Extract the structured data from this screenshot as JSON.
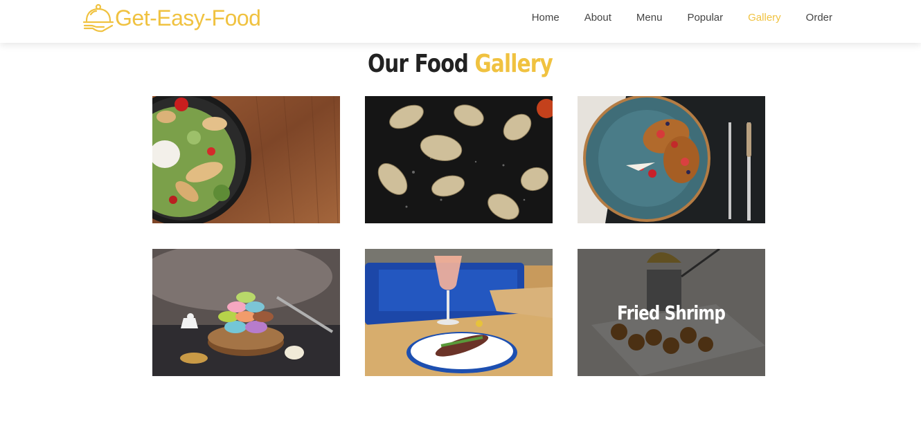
{
  "brand": {
    "name": "Get-Easy-Food",
    "logo_icon": "cloche-icon",
    "accent_color": "#f0c240"
  },
  "nav": {
    "items": [
      {
        "label": "Home",
        "active": false
      },
      {
        "label": "About",
        "active": false
      },
      {
        "label": "Menu",
        "active": false
      },
      {
        "label": "Popular",
        "active": false
      },
      {
        "label": "Gallery",
        "active": true
      },
      {
        "label": "Order",
        "active": false
      }
    ]
  },
  "gallery": {
    "title_dark": "Our Food",
    "title_accent": "Gallery",
    "items": [
      {
        "image": "salad-photo",
        "caption": ""
      },
      {
        "image": "dumplings-photo",
        "caption": ""
      },
      {
        "image": "french-toast-berries-photo",
        "caption": ""
      },
      {
        "image": "macarons-photo",
        "caption": ""
      },
      {
        "image": "cocktail-and-plate-photo",
        "caption": ""
      },
      {
        "image": "fried-shrimp-photo",
        "caption": "Fried Shrimp"
      }
    ]
  }
}
